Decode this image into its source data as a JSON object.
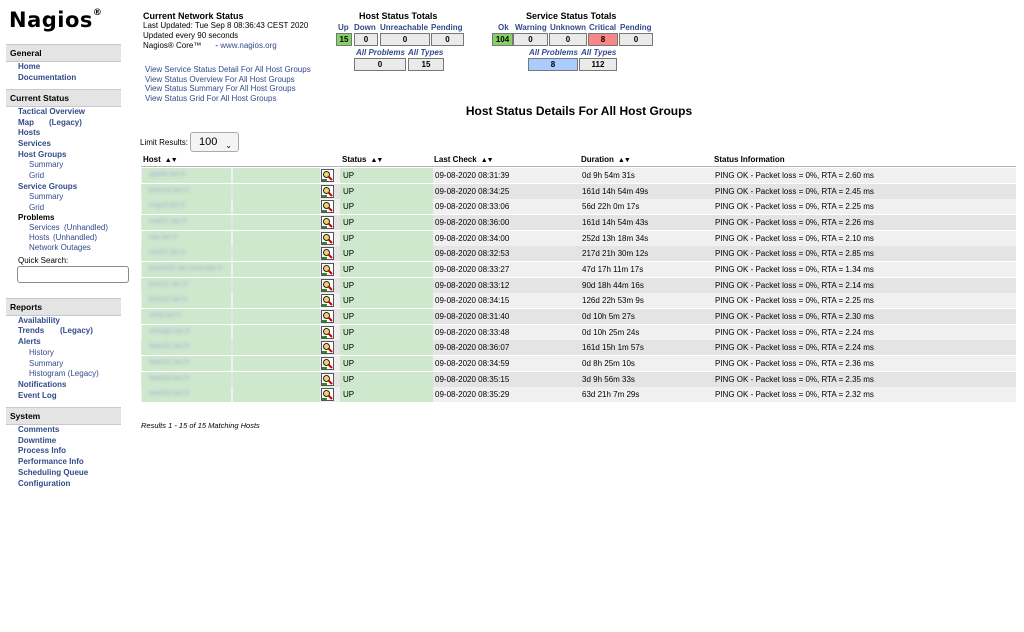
{
  "sidebar": {
    "logo": "Nagios",
    "sections": {
      "general": "General",
      "current_status": "Current Status",
      "reports": "Reports",
      "system": "System"
    },
    "general_items": [
      "Home",
      "Documentation"
    ],
    "current": {
      "tactical": "Tactical Overview",
      "map": "Map",
      "legacy": "(Legacy)",
      "hosts": "Hosts",
      "services": "Services",
      "host_groups": "Host Groups",
      "hg_summary": "Summary",
      "hg_grid": "Grid",
      "service_groups": "Service Groups",
      "sg_summary": "Summary",
      "sg_grid": "Grid",
      "problems": "Problems",
      "prob_services": "Services",
      "prob_hosts": "Hosts",
      "unhandled": "(Unhandled)",
      "network_outages": "Network Outages",
      "quick_search": "Quick Search:"
    },
    "reports": {
      "availability": "Availability",
      "trends": "Trends",
      "legacy": "(Legacy)",
      "alerts": "Alerts",
      "history": "History",
      "summary": "Summary",
      "histogram": "Histogram (Legacy)",
      "notifications": "Notifications",
      "event_log": "Event Log"
    },
    "system": [
      "Comments",
      "Downtime",
      "Process Info",
      "Performance Info",
      "Scheduling Queue",
      "Configuration"
    ]
  },
  "network_status": {
    "title": "Current Network Status",
    "last_updated": "Last Updated: Tue Sep 8 08:36:43 CEST 2020",
    "interval": "Updated every 90 seconds",
    "core": "Nagios® Core™",
    "url": "www.nagios.org"
  },
  "links": [
    "View Service Status Detail For All Host Groups",
    "View Status Overview For All Host Groups",
    "View Status Summary For All Host Groups",
    "View Status Grid For All Host Groups"
  ],
  "host_totals": {
    "title": "Host Status Totals",
    "headers": [
      "Up",
      "Down",
      "Unreachable",
      "Pending"
    ],
    "values": [
      "15",
      "0",
      "0",
      "0"
    ],
    "all_problems_label": "All Problems",
    "all_types_label": "All Types",
    "all_problems": "0",
    "all_types": "15"
  },
  "service_totals": {
    "title": "Service Status Totals",
    "headers": [
      "Ok",
      "Warning",
      "Unknown",
      "Critical",
      "Pending"
    ],
    "values": [
      "104",
      "0",
      "0",
      "8",
      "0"
    ],
    "all_problems_label": "All Problems",
    "all_types_label": "All Types",
    "all_problems": "8",
    "all_types": "112"
  },
  "colors": {
    "up_green": "#cde8cd",
    "ok_green": "#88d066",
    "critical_red": "#f88888",
    "problems_blue": "#aaccff",
    "link_blue": "#324b8b"
  },
  "page_title": "Host Status Details For All Host Groups",
  "limit": {
    "label": "Limit Results:",
    "value": "100"
  },
  "table": {
    "headers": [
      "Host",
      "Status",
      "Last Check",
      "Duration",
      "Status Information"
    ],
    "rows": [
      {
        "host": "apollo.lan.fr",
        "status": "UP",
        "last_check": "09-08-2020 08:31:39",
        "duration": "0d 9h 54m 31s",
        "info": "PING OK - Packet loss = 0%, RTA = 2.60 ms"
      },
      {
        "host": "backup.lan.fr",
        "status": "UP",
        "last_check": "09-08-2020 08:34:25",
        "duration": "161d 14h 54m 49s",
        "info": "PING OK - Packet loss = 0%, RTA = 2.45 ms"
      },
      {
        "host": "cisgrd.lan.fr",
        "status": "UP",
        "last_check": "09-08-2020 08:33:06",
        "duration": "56d 22h 0m 17s",
        "info": "PING OK - Packet loss = 0%, RTA = 2.25 ms"
      },
      {
        "host": "mail01.lan.fr",
        "status": "UP",
        "last_check": "09-08-2020 08:36:00",
        "duration": "161d 14h 54m 43s",
        "info": "PING OK - Packet loss = 0%, RTA = 2.26 ms"
      },
      {
        "host": "nas.lan.fr",
        "status": "UP",
        "last_check": "09-08-2020 08:34:00",
        "duration": "252d 13h 18m 34s",
        "info": "PING OK - Packet loss = 0%, RTA = 2.10 ms"
      },
      {
        "host": "nas01.lan.fr",
        "status": "UP",
        "last_check": "09-08-2020 08:32:53",
        "duration": "217d 21h 30m 12s",
        "info": "PING OK - Packet loss = 0%, RTA = 2.85 ms"
      },
      {
        "host": "printer01.lan.example.fr",
        "status": "UP",
        "last_check": "09-08-2020 08:33:27",
        "duration": "47d 17h 11m 17s",
        "info": "PING OK - Packet loss = 0%, RTA = 1.34 ms"
      },
      {
        "host": "proxy1.lan.fr",
        "status": "UP",
        "last_check": "09-08-2020 08:33:12",
        "duration": "90d 18h 44m 16s",
        "info": "PING OK - Packet loss = 0%, RTA = 2.14 ms"
      },
      {
        "host": "proxy2.lan.fr",
        "status": "UP",
        "last_check": "09-08-2020 08:34:15",
        "duration": "126d 22h 53m 9s",
        "info": "PING OK - Packet loss = 0%, RTA = 2.25 ms"
      },
      {
        "host": "relay.lan.fr",
        "status": "UP",
        "last_check": "09-08-2020 08:31:40",
        "duration": "0d 10h 5m 27s",
        "info": "PING OK - Packet loss = 0%, RTA = 2.30 ms"
      },
      {
        "host": "storage.lan.fr",
        "status": "UP",
        "last_check": "09-08-2020 08:33:48",
        "duration": "0d 10h 25m 24s",
        "info": "PING OK - Packet loss = 0%, RTA = 2.24 ms"
      },
      {
        "host": "www01.lan.fr",
        "status": "UP",
        "last_check": "09-08-2020 08:36:07",
        "duration": "161d 15h 1m 57s",
        "info": "PING OK - Packet loss = 0%, RTA = 2.24 ms"
      },
      {
        "host": "www02.lan.fr",
        "status": "UP",
        "last_check": "09-08-2020 08:34:59",
        "duration": "0d 8h 25m 10s",
        "info": "PING OK - Packet loss = 0%, RTA = 2.36 ms"
      },
      {
        "host": "www03.lan.fr",
        "status": "UP",
        "last_check": "09-08-2020 08:35:15",
        "duration": "3d 9h 56m 33s",
        "info": "PING OK - Packet loss = 0%, RTA = 2.35 ms"
      },
      {
        "host": "www04.lan.fr",
        "status": "UP",
        "last_check": "09-08-2020 08:35:29",
        "duration": "63d 21h 7m 29s",
        "info": "PING OK - Packet loss = 0%, RTA = 2.32 ms"
      }
    ]
  },
  "footer": "Results 1 - 15 of 15 Matching Hosts"
}
